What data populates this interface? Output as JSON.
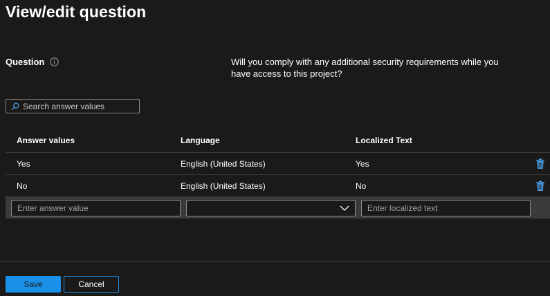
{
  "header": {
    "title": "View/edit question"
  },
  "question": {
    "label": "Question",
    "text": "Will you comply with any additional security requirements while you have access to this project?",
    "info_icon": "info-icon"
  },
  "search": {
    "placeholder": "Search answer values",
    "value": "",
    "icon": "search-icon"
  },
  "table": {
    "columns": [
      "Answer values",
      "Language",
      "Localized Text"
    ],
    "rows": [
      {
        "answer": "Yes",
        "language": "English (United States)",
        "localized": "Yes",
        "action_icon": "trash-icon"
      },
      {
        "answer": "No",
        "language": "English (United States)",
        "localized": "No",
        "action_icon": "trash-icon"
      }
    ],
    "new_row": {
      "answer_placeholder": "Enter answer value",
      "language_value": "",
      "localized_placeholder": "Enter localized text",
      "dropdown_icon": "chevron-down-icon"
    }
  },
  "footer": {
    "save_label": "Save",
    "cancel_label": "Cancel"
  },
  "colors": {
    "background": "#1b1a19",
    "accent": "#1b90e8",
    "border": "#8a8886",
    "row_divider": "#3b3a39",
    "trash_icon": "#4aa0e6"
  }
}
